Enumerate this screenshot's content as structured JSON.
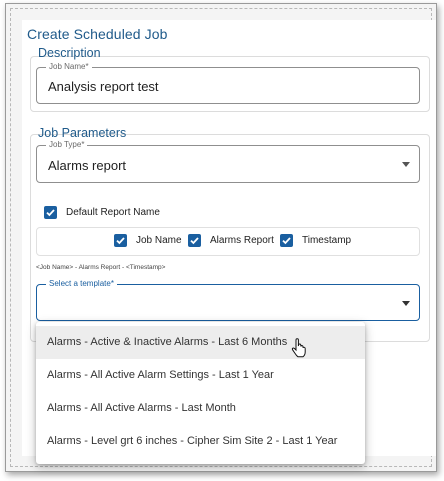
{
  "dialog": {
    "title": "Create Scheduled Job"
  },
  "description": {
    "section_label": "Description",
    "job_name": {
      "label": "Job Name*",
      "value": "Analysis report test"
    }
  },
  "parameters": {
    "section_label": "Job Parameters",
    "job_type": {
      "label": "Job Type*",
      "value": "Alarms report",
      "icon": "chevron-down-icon"
    },
    "default_report_name": {
      "label": "Default Report Name",
      "checked": true
    },
    "name_parts": [
      {
        "label": "Job Name",
        "checked": true
      },
      {
        "label": "Alarms Report",
        "checked": true
      },
      {
        "label": "Timestamp",
        "checked": true
      }
    ],
    "name_preview": "<Job Name> - Alarms Report - <Timestamp>",
    "template": {
      "label": "Select a template*",
      "value": "",
      "icon": "chevron-down-icon"
    }
  },
  "template_menu": {
    "items": [
      "Alarms - Active & Inactive Alarms - Last 6 Months",
      "Alarms - All Active Alarm Settings - Last 1 Year",
      "Alarms - All Active Alarms - Last Month",
      "Alarms - Level grt 6 inches - Cipher Sim Site 2 - Last 1 Year"
    ],
    "hovered_index": 0
  },
  "colors": {
    "accent": "#1a5fa0",
    "title": "#1f5a8a"
  }
}
